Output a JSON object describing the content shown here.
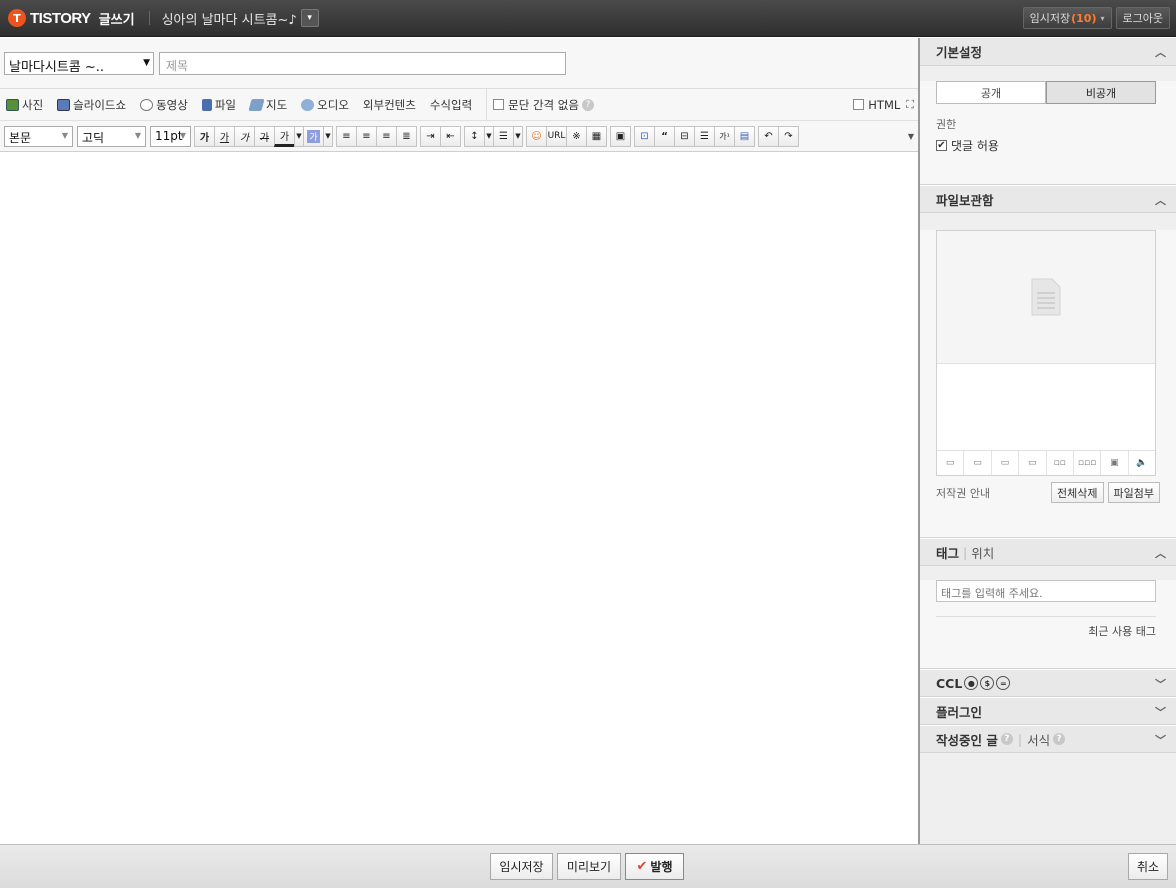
{
  "topbar": {
    "logo": "TISTORY",
    "logo_mark": "T",
    "write": "글쓰기",
    "blog_name": "싱아의 날마다 시트콤~♪",
    "temp_save_label": "임시저장",
    "temp_save_count": "(10)",
    "logout": "로그아웃"
  },
  "title_row": {
    "category": "날마다시트콤 ~..",
    "title_placeholder": "제목"
  },
  "toolbar1": {
    "items": [
      "사진",
      "슬라이드쇼",
      "동영상",
      "파일",
      "지도",
      "오디오",
      "외부컨텐츠",
      "수식입력"
    ],
    "paragraph_spacing": "문단 간격 없음",
    "html": "HTML"
  },
  "toolbar2": {
    "style": "본문",
    "font": "고딕",
    "size": "11pt",
    "format_buttons": [
      "가",
      "가",
      "가",
      "가",
      "가"
    ],
    "url": "URL"
  },
  "sidebar": {
    "basic": {
      "title": "기본설정",
      "public": "공개",
      "private": "비공개",
      "permission": "권한",
      "allow_comments": "댓글 허용"
    },
    "files": {
      "title": "파일보관함",
      "copyright": "저작권 안내",
      "delete_all": "전체삭제",
      "attach": "파일첨부"
    },
    "tags": {
      "title": "태그",
      "location": "위치",
      "placeholder": "태그를 입력해 주세요.",
      "recent": "최근 사용 태그"
    },
    "ccl": "CCL",
    "plugins": "플러그인",
    "drafts": "작성중인 글",
    "format": "서식"
  },
  "bottom": {
    "temp_save": "임시저장",
    "preview": "미리보기",
    "publish": "발행",
    "cancel": "취소"
  },
  "colors": {
    "accent": "#eb531f",
    "topbar": "#3a3a3a"
  }
}
